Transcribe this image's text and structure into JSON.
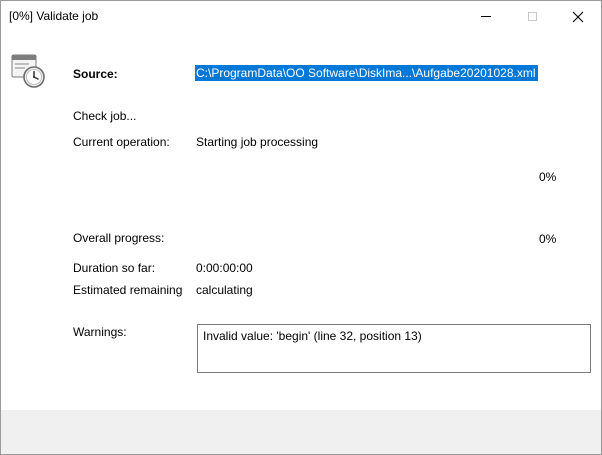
{
  "window": {
    "title": "[0%] Validate job"
  },
  "icons": {
    "app": "scheduled-task-clock-icon",
    "minimize": "minimize-icon",
    "maximize": "maximize-icon",
    "close": "close-icon"
  },
  "colors": {
    "selection": "#0078d7",
    "footer": "#f0f0f0"
  },
  "source": {
    "label": "Source:",
    "value": "C:\\ProgramData\\OO Software\\DiskIma...\\Aufgabe20201028.xml"
  },
  "status": {
    "check_job": "Check job...",
    "current_operation_label": "Current operation:",
    "current_operation_value": "Starting job processing",
    "operation_progress": "0%",
    "overall_progress_label": "Overall progress:",
    "overall_progress": "0%",
    "duration_label": "Duration so far:",
    "duration_value": "0:00:00:00",
    "estimated_label": "Estimated remaining",
    "estimated_value": "calculating"
  },
  "warnings": {
    "label": "Warnings:",
    "text": "Invalid value: 'begin' (line 32, position 13)"
  }
}
